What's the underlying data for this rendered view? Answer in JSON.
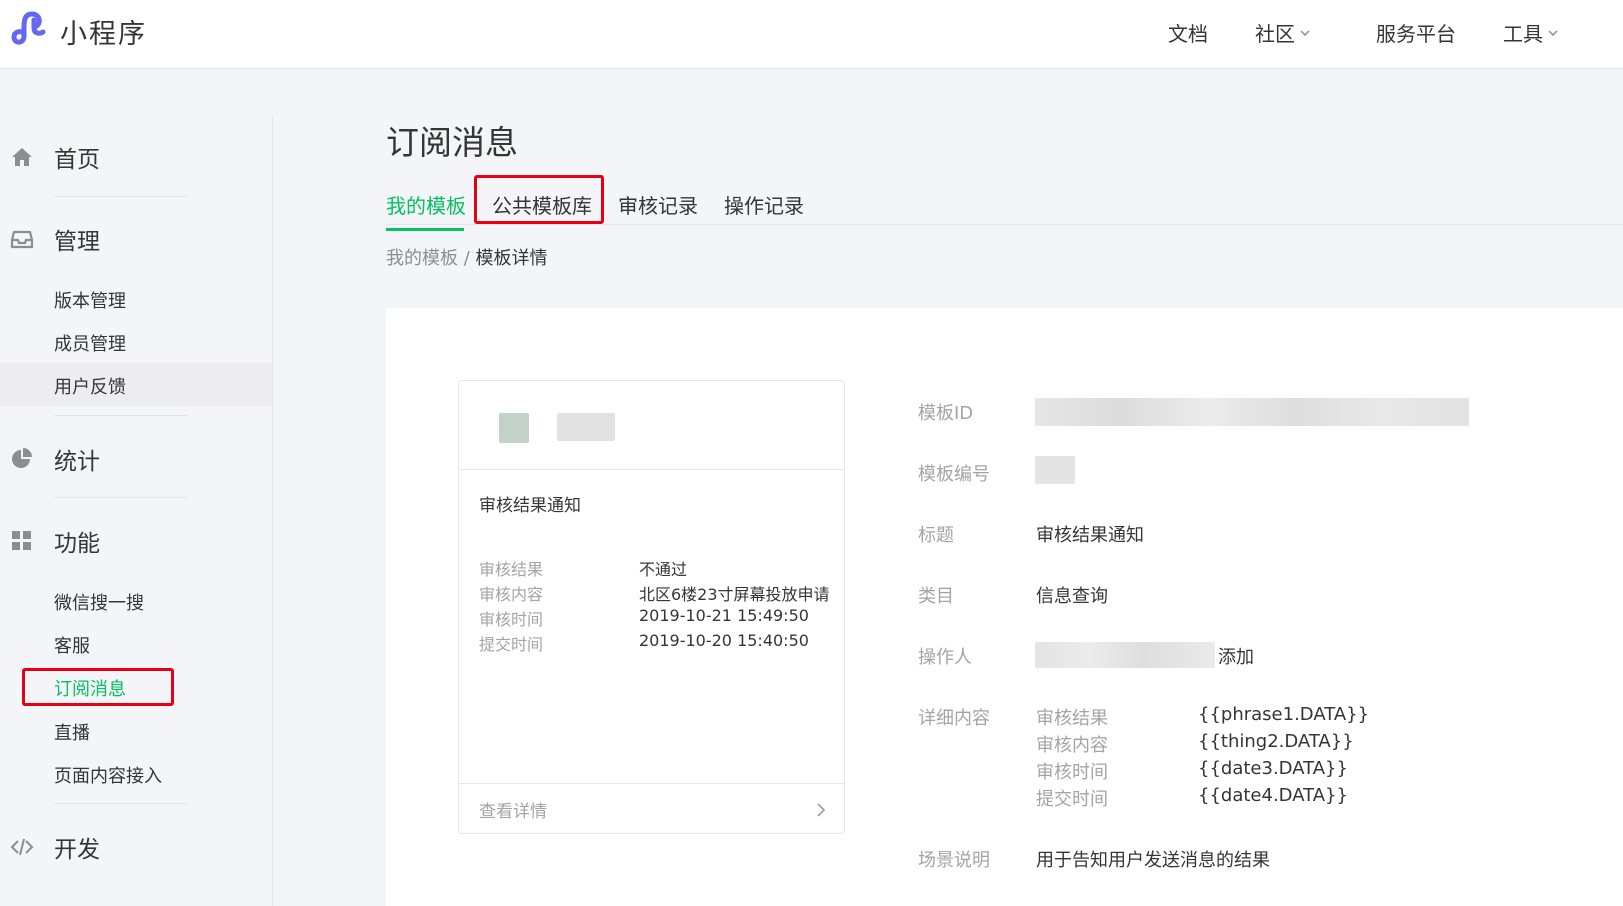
{
  "app": {
    "brand": "小程序"
  },
  "topnav": [
    {
      "label": "文档",
      "dropdown": false
    },
    {
      "label": "社区",
      "dropdown": true
    },
    {
      "label": "服务平台",
      "dropdown": false
    },
    {
      "label": "工具",
      "dropdown": true
    }
  ],
  "sidebar": {
    "home": {
      "label": "首页",
      "icon": "home-icon"
    },
    "manage": {
      "label": "管理",
      "icon": "inbox-icon",
      "items": [
        "版本管理",
        "成员管理",
        "用户反馈"
      ]
    },
    "stats": {
      "label": "统计",
      "icon": "pie-chart-icon"
    },
    "features": {
      "label": "功能",
      "icon": "grid-icon",
      "items": [
        "微信搜一搜",
        "客服",
        "订阅消息",
        "直播",
        "页面内容接入"
      ]
    },
    "dev": {
      "label": "开发",
      "icon": "code-icon"
    }
  },
  "page": {
    "title": "订阅消息",
    "tabs": [
      "我的模板",
      "公共模板库",
      "审核记录",
      "操作记录"
    ],
    "active_tab": "我的模板",
    "breadcrumb": {
      "parent": "我的模板",
      "separator": "/",
      "current": "模板详情"
    }
  },
  "preview": {
    "title": "审核结果通知",
    "rows": [
      {
        "key": "审核结果",
        "value": "不通过"
      },
      {
        "key": "审核内容",
        "value": "北区6楼23寸屏幕投放申请"
      },
      {
        "key": "审核时间",
        "value": "2019-10-21 15:49:50"
      },
      {
        "key": "提交时间",
        "value": "2019-10-20 15:40:50"
      }
    ],
    "footer": "查看详情"
  },
  "detail": {
    "labels": {
      "template_id": "模板ID",
      "template_no": "模板编号",
      "title": "标题",
      "category": "类目",
      "operator": "操作人",
      "content": "详细内容",
      "scene": "场景说明"
    },
    "title": "审核结果通知",
    "category": "信息查询",
    "operator_suffix": "添加",
    "fields": [
      {
        "name": "审核结果",
        "key": "{{phrase1.DATA}}"
      },
      {
        "name": "审核内容",
        "key": "{{thing2.DATA}}"
      },
      {
        "name": "审核时间",
        "key": "{{date3.DATA}}"
      },
      {
        "name": "提交时间",
        "key": "{{date4.DATA}}"
      }
    ],
    "scene": "用于告知用户发送消息的结果"
  },
  "colors": {
    "accent": "#07c160",
    "highlight": "#e60012",
    "brand_purple": "#6467f0"
  }
}
